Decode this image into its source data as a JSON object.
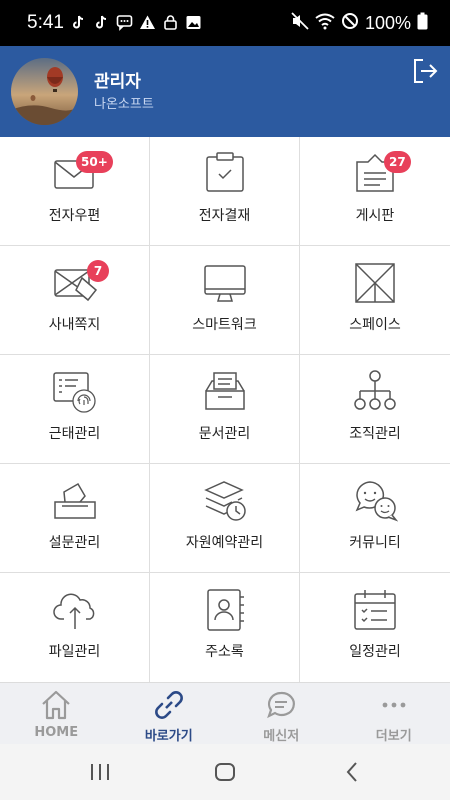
{
  "status_bar": {
    "time": "5:41",
    "battery": "100%",
    "icons_left": [
      "tiktok-icon",
      "tiktok-icon",
      "message-icon",
      "warning-icon",
      "lock-icon",
      "image-icon"
    ],
    "icons_right": [
      "mute-icon",
      "wifi-icon",
      "block-icon",
      "battery-icon"
    ]
  },
  "header": {
    "user_name": "관리자",
    "org_name": "나온소프트",
    "bg_color": "#2c5aa0"
  },
  "grid": {
    "items": [
      {
        "label": "전자우편",
        "icon": "mail-icon",
        "badge": "50+"
      },
      {
        "label": "전자결재",
        "icon": "approval-clipboard-icon",
        "badge": ""
      },
      {
        "label": "게시판",
        "icon": "board-icon",
        "badge": "27"
      },
      {
        "label": "사내쪽지",
        "icon": "note-envelope-icon",
        "badge": "7"
      },
      {
        "label": "스마트워크",
        "icon": "monitor-icon",
        "badge": ""
      },
      {
        "label": "스페이스",
        "icon": "space-icon",
        "badge": ""
      },
      {
        "label": "근태관리",
        "icon": "fingerprint-icon",
        "badge": ""
      },
      {
        "label": "문서관리",
        "icon": "document-tray-icon",
        "badge": ""
      },
      {
        "label": "조직관리",
        "icon": "org-chart-icon",
        "badge": ""
      },
      {
        "label": "설문관리",
        "icon": "ballot-box-icon",
        "badge": ""
      },
      {
        "label": "자원예약관리",
        "icon": "resource-clock-icon",
        "badge": ""
      },
      {
        "label": "커뮤니티",
        "icon": "community-chat-icon",
        "badge": ""
      },
      {
        "label": "파일관리",
        "icon": "cloud-upload-icon",
        "badge": ""
      },
      {
        "label": "주소록",
        "icon": "address-book-icon",
        "badge": ""
      },
      {
        "label": "일정관리",
        "icon": "calendar-icon",
        "badge": ""
      }
    ],
    "badge_color": "#e8405a"
  },
  "bottom_nav": {
    "items": [
      {
        "label": "HOME",
        "icon": "home-icon",
        "active": false
      },
      {
        "label": "바로가기",
        "icon": "link-icon",
        "active": true
      },
      {
        "label": "메신저",
        "icon": "messenger-icon",
        "active": false
      },
      {
        "label": "더보기",
        "icon": "more-icon",
        "active": false
      }
    ],
    "active_color": "#2c4a87"
  }
}
